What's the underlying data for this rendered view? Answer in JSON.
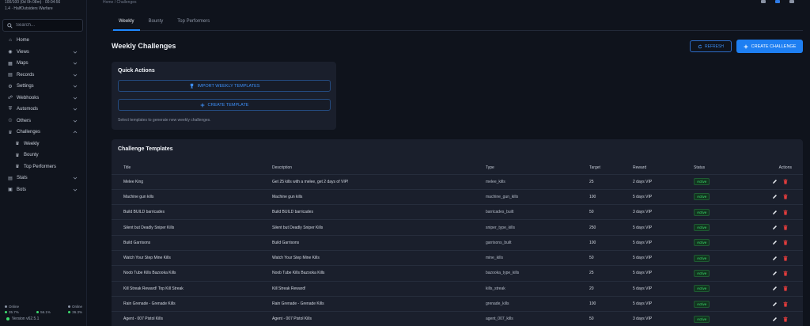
{
  "sidebar": {
    "server_line1": "100/100 (0d 0h 08m) · 00:04:56",
    "server_line2": "1.4 · HalfOutsiders Warfare",
    "search_placeholder": "Search...",
    "items": [
      {
        "label": "Home",
        "icon": "home-icon"
      },
      {
        "label": "Views",
        "icon": "eye-icon"
      },
      {
        "label": "Maps",
        "icon": "map-icon"
      },
      {
        "label": "Records",
        "icon": "records-icon"
      },
      {
        "label": "Settings",
        "icon": "gear-icon"
      },
      {
        "label": "Webhooks",
        "icon": "webhook-icon"
      },
      {
        "label": "Automods",
        "icon": "shield-icon"
      },
      {
        "label": "Others",
        "icon": "globe-icon"
      },
      {
        "label": "Challenges",
        "icon": "trophy-icon"
      }
    ],
    "challenges_sub": [
      {
        "label": "Weekly",
        "icon": "trophy-icon"
      },
      {
        "label": "Bounty",
        "icon": "trophy-icon"
      },
      {
        "label": "Top Performers",
        "icon": "trophy-icon"
      }
    ],
    "items_after": [
      {
        "label": "Stats",
        "icon": "stats-icon"
      },
      {
        "label": "Bots",
        "icon": "bot-icon"
      }
    ],
    "footer": {
      "left_label": "Online",
      "right_label": "Online",
      "stat1": "35.7%",
      "stat2": "56.1%",
      "stat3": "36.3%",
      "version": "Version v62.5.1"
    }
  },
  "topbar": {
    "breadcrumb": "Home / Challenges"
  },
  "tabs": [
    "Weekly",
    "Bounty",
    "Top Performers"
  ],
  "page": {
    "title": "Weekly Challenges",
    "refresh_label": "REFRESH",
    "create_label": "CREATE CHALLENGE"
  },
  "quick_actions": {
    "title": "Quick Actions",
    "import_label": "IMPORT WEEKLY TEMPLATES",
    "create_template_label": "CREATE TEMPLATE",
    "hint": "Select templates to generate new weekly challenges."
  },
  "templates": {
    "title": "Challenge Templates",
    "columns": [
      "Title",
      "Description",
      "Type",
      "Target",
      "Reward",
      "Status",
      "Actions"
    ],
    "rows": [
      {
        "title": "Melee King",
        "description": "Get 25 kills with a melee, get 2 days of VIP!",
        "type": "melee_kills",
        "target": "25",
        "reward": "2 days VIP",
        "status": "Active"
      },
      {
        "title": "Machine gun kills",
        "description": "Machine gun kills",
        "type": "machine_gun_kills",
        "target": "100",
        "reward": "5 days VIP",
        "status": "Active"
      },
      {
        "title": "Build BUILD barricades",
        "description": "Build BUILD barricades",
        "type": "barricades_built",
        "target": "50",
        "reward": "3 days VIP",
        "status": "Active"
      },
      {
        "title": "Silent but Deadly Sniper Kills",
        "description": "Silent but Deadly Sniper Kills",
        "type": "sniper_type_kills",
        "target": "250",
        "reward": "5 days VIP",
        "status": "Active"
      },
      {
        "title": "Build Garrisons",
        "description": "Build Garrisons",
        "type": "garrisons_built",
        "target": "100",
        "reward": "5 days VIP",
        "status": "Active"
      },
      {
        "title": "Watch Your Step Mine Kills",
        "description": "Watch Your Step Mine Kills",
        "type": "mine_kills",
        "target": "50",
        "reward": "5 days VIP",
        "status": "Active"
      },
      {
        "title": "Noob Tube Kills Bazooka Kills",
        "description": "Noob Tube Kills Bazooka Kills",
        "type": "bazooka_type_kills",
        "target": "25",
        "reward": "5 days VIP",
        "status": "Active"
      },
      {
        "title": "Kill Streak Reward! Top Kill Streak",
        "description": "Kill Streak Reward!",
        "type": "kills_streak",
        "target": "20",
        "reward": "5 days VIP",
        "status": "Active"
      },
      {
        "title": "Rain Grenade - Grenade Kills",
        "description": "Rain Grenade - Grenade Kills",
        "type": "grenade_kills",
        "target": "100",
        "reward": "5 days VIP",
        "status": "Active"
      },
      {
        "title": "Agent - 007 Pistol Kills",
        "description": "Agent - 007 Pistol Kills",
        "type": "agent_007_kills",
        "target": "50",
        "reward": "3 days VIP",
        "status": "Active"
      }
    ]
  },
  "colors": {
    "accent": "#1e7ff2",
    "active_badge": "#3ddc6f",
    "delete": "#e23c3c"
  }
}
